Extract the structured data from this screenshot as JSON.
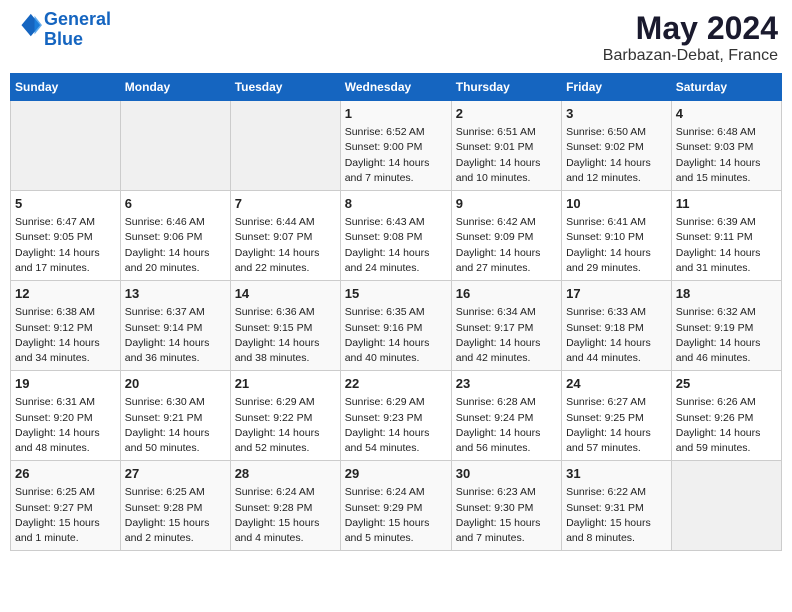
{
  "header": {
    "logo_line1": "General",
    "logo_line2": "Blue",
    "month": "May 2024",
    "location": "Barbazan-Debat, France"
  },
  "weekdays": [
    "Sunday",
    "Monday",
    "Tuesday",
    "Wednesday",
    "Thursday",
    "Friday",
    "Saturday"
  ],
  "weeks": [
    [
      {
        "day": "",
        "info": ""
      },
      {
        "day": "",
        "info": ""
      },
      {
        "day": "",
        "info": ""
      },
      {
        "day": "1",
        "info": "Sunrise: 6:52 AM\nSunset: 9:00 PM\nDaylight: 14 hours\nand 7 minutes."
      },
      {
        "day": "2",
        "info": "Sunrise: 6:51 AM\nSunset: 9:01 PM\nDaylight: 14 hours\nand 10 minutes."
      },
      {
        "day": "3",
        "info": "Sunrise: 6:50 AM\nSunset: 9:02 PM\nDaylight: 14 hours\nand 12 minutes."
      },
      {
        "day": "4",
        "info": "Sunrise: 6:48 AM\nSunset: 9:03 PM\nDaylight: 14 hours\nand 15 minutes."
      }
    ],
    [
      {
        "day": "5",
        "info": "Sunrise: 6:47 AM\nSunset: 9:05 PM\nDaylight: 14 hours\nand 17 minutes."
      },
      {
        "day": "6",
        "info": "Sunrise: 6:46 AM\nSunset: 9:06 PM\nDaylight: 14 hours\nand 20 minutes."
      },
      {
        "day": "7",
        "info": "Sunrise: 6:44 AM\nSunset: 9:07 PM\nDaylight: 14 hours\nand 22 minutes."
      },
      {
        "day": "8",
        "info": "Sunrise: 6:43 AM\nSunset: 9:08 PM\nDaylight: 14 hours\nand 24 minutes."
      },
      {
        "day": "9",
        "info": "Sunrise: 6:42 AM\nSunset: 9:09 PM\nDaylight: 14 hours\nand 27 minutes."
      },
      {
        "day": "10",
        "info": "Sunrise: 6:41 AM\nSunset: 9:10 PM\nDaylight: 14 hours\nand 29 minutes."
      },
      {
        "day": "11",
        "info": "Sunrise: 6:39 AM\nSunset: 9:11 PM\nDaylight: 14 hours\nand 31 minutes."
      }
    ],
    [
      {
        "day": "12",
        "info": "Sunrise: 6:38 AM\nSunset: 9:12 PM\nDaylight: 14 hours\nand 34 minutes."
      },
      {
        "day": "13",
        "info": "Sunrise: 6:37 AM\nSunset: 9:14 PM\nDaylight: 14 hours\nand 36 minutes."
      },
      {
        "day": "14",
        "info": "Sunrise: 6:36 AM\nSunset: 9:15 PM\nDaylight: 14 hours\nand 38 minutes."
      },
      {
        "day": "15",
        "info": "Sunrise: 6:35 AM\nSunset: 9:16 PM\nDaylight: 14 hours\nand 40 minutes."
      },
      {
        "day": "16",
        "info": "Sunrise: 6:34 AM\nSunset: 9:17 PM\nDaylight: 14 hours\nand 42 minutes."
      },
      {
        "day": "17",
        "info": "Sunrise: 6:33 AM\nSunset: 9:18 PM\nDaylight: 14 hours\nand 44 minutes."
      },
      {
        "day": "18",
        "info": "Sunrise: 6:32 AM\nSunset: 9:19 PM\nDaylight: 14 hours\nand 46 minutes."
      }
    ],
    [
      {
        "day": "19",
        "info": "Sunrise: 6:31 AM\nSunset: 9:20 PM\nDaylight: 14 hours\nand 48 minutes."
      },
      {
        "day": "20",
        "info": "Sunrise: 6:30 AM\nSunset: 9:21 PM\nDaylight: 14 hours\nand 50 minutes."
      },
      {
        "day": "21",
        "info": "Sunrise: 6:29 AM\nSunset: 9:22 PM\nDaylight: 14 hours\nand 52 minutes."
      },
      {
        "day": "22",
        "info": "Sunrise: 6:29 AM\nSunset: 9:23 PM\nDaylight: 14 hours\nand 54 minutes."
      },
      {
        "day": "23",
        "info": "Sunrise: 6:28 AM\nSunset: 9:24 PM\nDaylight: 14 hours\nand 56 minutes."
      },
      {
        "day": "24",
        "info": "Sunrise: 6:27 AM\nSunset: 9:25 PM\nDaylight: 14 hours\nand 57 minutes."
      },
      {
        "day": "25",
        "info": "Sunrise: 6:26 AM\nSunset: 9:26 PM\nDaylight: 14 hours\nand 59 minutes."
      }
    ],
    [
      {
        "day": "26",
        "info": "Sunrise: 6:25 AM\nSunset: 9:27 PM\nDaylight: 15 hours\nand 1 minute."
      },
      {
        "day": "27",
        "info": "Sunrise: 6:25 AM\nSunset: 9:28 PM\nDaylight: 15 hours\nand 2 minutes."
      },
      {
        "day": "28",
        "info": "Sunrise: 6:24 AM\nSunset: 9:28 PM\nDaylight: 15 hours\nand 4 minutes."
      },
      {
        "day": "29",
        "info": "Sunrise: 6:24 AM\nSunset: 9:29 PM\nDaylight: 15 hours\nand 5 minutes."
      },
      {
        "day": "30",
        "info": "Sunrise: 6:23 AM\nSunset: 9:30 PM\nDaylight: 15 hours\nand 7 minutes."
      },
      {
        "day": "31",
        "info": "Sunrise: 6:22 AM\nSunset: 9:31 PM\nDaylight: 15 hours\nand 8 minutes."
      },
      {
        "day": "",
        "info": ""
      }
    ]
  ]
}
